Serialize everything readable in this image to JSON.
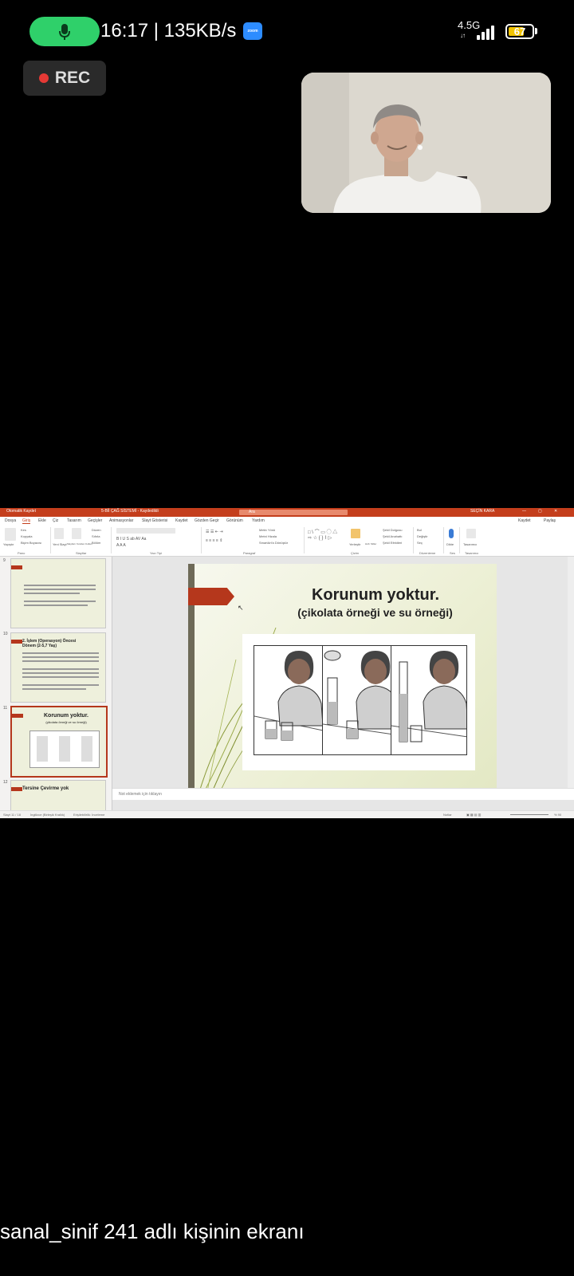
{
  "status_bar": {
    "time_speed": "16:17 | 135KB/s",
    "zoom_badge": "zoom",
    "network": "4.5G",
    "network_arrows": "↓↑",
    "battery": "67",
    "battery_level": 0.67,
    "mic_icon": "microphone-icon"
  },
  "rec": {
    "label": "REC"
  },
  "ppt": {
    "autosave": "Otomatik Kaydet",
    "doc_title": "5-Bİİ ÇAĞ SİSTEMİ - Kaydedildi",
    "search": "Ara",
    "user": "SEÇİN KARA",
    "menu": [
      "Dosya",
      "Giriş",
      "Ekle",
      "Çiz",
      "Tasarım",
      "Geçişler",
      "Animasyonlar",
      "Slayt Gösterisi",
      "Kaydet",
      "Gözden Geçir",
      "Görünüm",
      "Yardım"
    ],
    "record_btn": "Kaydet",
    "share_btn": "Paylaş",
    "ribbon_groups": [
      "Pano",
      "Slaytlar",
      "Yazı Tipi",
      "Paragraf",
      "Çizim",
      "Düzenleme",
      "Ses",
      "Tasarımcı"
    ],
    "ribbon_labels": {
      "paste": "Yapıştır",
      "cut": "Kes",
      "copy": "Kopyala",
      "format": "Biçim Boyacısı",
      "new_slide": "Yeni Slayt",
      "reuse": "Slaytları Yeniden Kullan",
      "layout": "Düzen",
      "reset": "Sıfırla",
      "section": "Bölüm",
      "find": "Bul",
      "replace": "Değiştir",
      "select": "Seç",
      "dictate": "Dikte",
      "designer": "Tasarımcı",
      "arrange": "Yerleştir",
      "quick_styles": "Hızlı Stiller",
      "shape_fill": "Şekil Dolgusu",
      "shape_outline": "Şekil Anahattı",
      "shape_effects": "Şekil Efektleri",
      "text_direction": "Metin Yönü",
      "align_text": "Metni Hizala",
      "smartart": "SmartArt'a Dönüştür"
    },
    "thumbnails": [
      {
        "num": "9",
        "title": ""
      },
      {
        "num": "10",
        "title": "2. İşlem (Operasyon) Öncesi Dönem (2-5,7 Yaş)"
      },
      {
        "num": "11",
        "title": "Korunum yoktur.",
        "subtitle": "(çikolata örneği ve su örneği)"
      },
      {
        "num": "12",
        "title": "Tersine Çevirme yok"
      }
    ],
    "slide": {
      "title": "Korunum yoktur.",
      "subtitle": "(çikolata örneği ve su örneği)"
    },
    "notes_placeholder": "Not eklemek için tıklayın",
    "status": {
      "slide_count": "Slayt 11 / 18",
      "language": "İngilizce (Birleşik Krallık)",
      "accessibility": "Erişilebilirlik: İnceleme",
      "notes": "Notlar",
      "zoom": "% 90"
    }
  },
  "caption": "sanal_sinif 241 adlı kişinin ekranı"
}
